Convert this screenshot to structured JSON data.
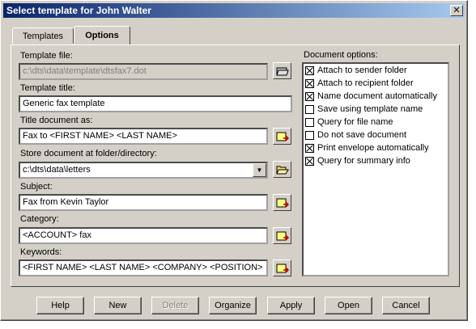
{
  "window": {
    "title": "Select template for John Walter"
  },
  "tabs": [
    {
      "label": "Templates"
    },
    {
      "label": "Options"
    }
  ],
  "fields": {
    "template_file": {
      "label": "Template file:",
      "value": "c:\\dts\\data\\template\\dtsfax7.dot"
    },
    "template_title": {
      "label": "Template title:",
      "value": "Generic fax template"
    },
    "title_document_as": {
      "label": "Title document as:",
      "value": "Fax to <FIRST NAME> <LAST NAME>"
    },
    "store_folder": {
      "label": "Store document at folder/directory:",
      "value": "c:\\dts\\data\\letters"
    },
    "subject": {
      "label": "Subject:",
      "value": "Fax from Kevin Taylor"
    },
    "category": {
      "label": "Category:",
      "value": "<ACCOUNT> fax"
    },
    "keywords": {
      "label": "Keywords:",
      "value": "<FIRST NAME> <LAST NAME> <COMPANY> <POSITION>"
    }
  },
  "document_options": {
    "label": "Document options:",
    "items": [
      {
        "label": "Attach to sender folder",
        "checked": true
      },
      {
        "label": "Attach to recipient folder",
        "checked": true
      },
      {
        "label": "Name document automatically",
        "checked": true
      },
      {
        "label": "Save using template name",
        "checked": false
      },
      {
        "label": "Query for file name",
        "checked": false
      },
      {
        "label": "Do not save document",
        "checked": false
      },
      {
        "label": "Print envelope automatically",
        "checked": true
      },
      {
        "label": "Query for summary info",
        "checked": true
      }
    ]
  },
  "buttons": [
    {
      "label": "Help",
      "enabled": true
    },
    {
      "label": "New",
      "enabled": true
    },
    {
      "label": "Delete",
      "enabled": false
    },
    {
      "label": "Organize",
      "enabled": true
    },
    {
      "label": "Apply",
      "enabled": true
    },
    {
      "label": "Open",
      "enabled": true
    },
    {
      "label": "Cancel",
      "enabled": true
    }
  ]
}
